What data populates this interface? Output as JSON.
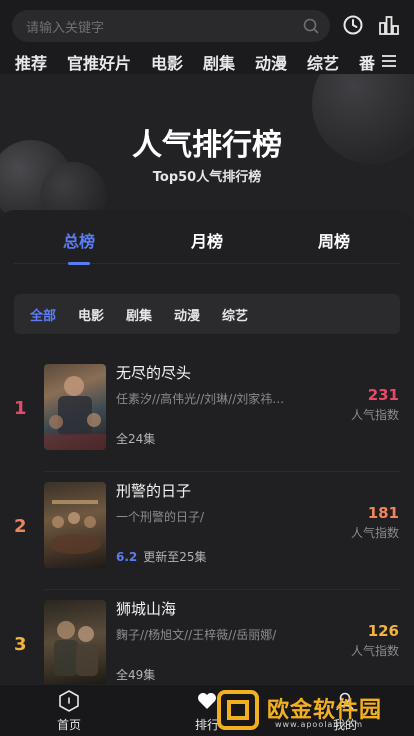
{
  "search": {
    "placeholder": "请输入关键字"
  },
  "nav": [
    "推荐",
    "官推好片",
    "电影",
    "剧集",
    "动漫",
    "综艺",
    "番"
  ],
  "hero": {
    "title": "人气排行榜",
    "subtitle": "Top50人气排行榜"
  },
  "tabs": [
    "总榜",
    "月榜",
    "周榜"
  ],
  "filters": [
    "全部",
    "电影",
    "剧集",
    "动漫",
    "综艺"
  ],
  "list": [
    {
      "rank": "1",
      "title": "无尽的尽头",
      "cast": "任素汐//高伟光//刘琳//刘家祎…",
      "score": "",
      "meta": "全24集",
      "heat": "231",
      "heat_label": "人气指数",
      "rank_color": "#e8496b"
    },
    {
      "rank": "2",
      "title": "刑警的日子",
      "cast": "一个刑警的日子/",
      "score": "6.2",
      "meta": "更新至25集",
      "heat": "181",
      "heat_label": "人气指数",
      "rank_color": "#f0855a"
    },
    {
      "rank": "3",
      "title": "狮城山海",
      "cast": "麴子//杨旭文//王梓薇//岳丽娜/",
      "score": "",
      "meta": "全49集",
      "heat": "126",
      "heat_label": "人气指数",
      "rank_color": "#f2b33f"
    }
  ],
  "bottom_nav": [
    "首页",
    "排行",
    "我的"
  ],
  "watermark": {
    "text": "欧金软件园",
    "url": "www.apoolan.com"
  },
  "colors": {
    "accent": "#5b7cf5",
    "bg": "#1d1d1f"
  }
}
